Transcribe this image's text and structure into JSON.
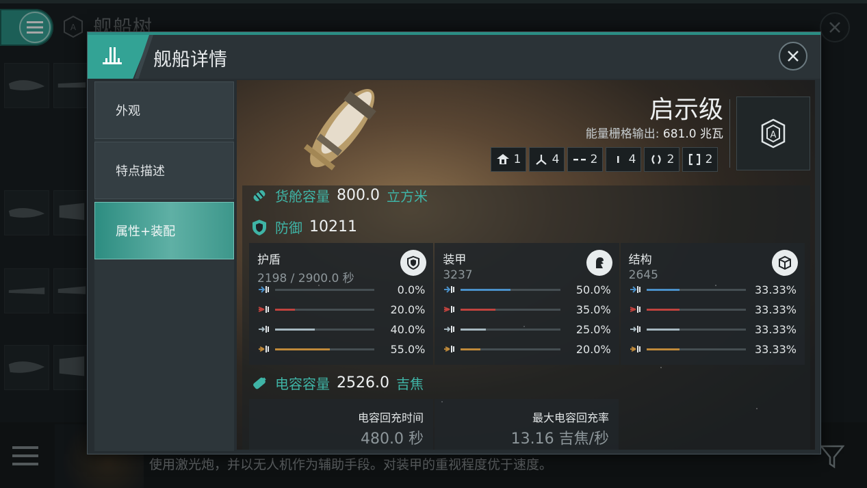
{
  "background": {
    "page_title": "舰船树",
    "description": "使用激光炮，并以无人机作为辅助手段。对装甲的重视程度优于速度。"
  },
  "modal": {
    "title": "舰船详情",
    "sidebar": [
      {
        "label": "外观",
        "active": false
      },
      {
        "label": "特点描述",
        "active": false
      },
      {
        "label": "属性+装配",
        "active": true
      }
    ]
  },
  "ship": {
    "name": "启示级",
    "power_label": "能量栅格输出:",
    "power_value": "681.0",
    "power_unit": "兆瓦",
    "slots": [
      {
        "icon": "high-slot-icon",
        "count": "1"
      },
      {
        "icon": "drone-slot-icon",
        "count": "4"
      },
      {
        "icon": "mid-slot-icon",
        "count": "2"
      },
      {
        "icon": "low-slot-icon",
        "count": "4"
      },
      {
        "icon": "rig-slot-icon",
        "count": "2"
      },
      {
        "icon": "subsystem-slot-icon",
        "count": "2"
      }
    ]
  },
  "cargo": {
    "label": "货舱容量",
    "value": "800.0",
    "unit": "立方米"
  },
  "defense": {
    "label": "防御",
    "value": "10211",
    "columns": [
      {
        "name": "护盾",
        "sub": "2198 / 2900.0 秒",
        "icon": "shield-icon",
        "resists": [
          {
            "type": "em",
            "pct": "0.0%",
            "value": 0.0
          },
          {
            "type": "thermal",
            "pct": "20.0%",
            "value": 0.2
          },
          {
            "type": "kinetic",
            "pct": "40.0%",
            "value": 0.4
          },
          {
            "type": "explosive",
            "pct": "55.0%",
            "value": 0.55
          }
        ]
      },
      {
        "name": "装甲",
        "sub": "3237",
        "icon": "armor-icon",
        "resists": [
          {
            "type": "em",
            "pct": "50.0%",
            "value": 0.5
          },
          {
            "type": "thermal",
            "pct": "35.0%",
            "value": 0.35
          },
          {
            "type": "kinetic",
            "pct": "25.0%",
            "value": 0.25
          },
          {
            "type": "explosive",
            "pct": "20.0%",
            "value": 0.2
          }
        ]
      },
      {
        "name": "结构",
        "sub": "2645",
        "icon": "structure-icon",
        "resists": [
          {
            "type": "em",
            "pct": "33.33%",
            "value": 0.3333
          },
          {
            "type": "thermal",
            "pct": "33.33%",
            "value": 0.3333
          },
          {
            "type": "kinetic",
            "pct": "33.33%",
            "value": 0.3333
          },
          {
            "type": "explosive",
            "pct": "33.33%",
            "value": 0.3333
          }
        ]
      }
    ]
  },
  "capacitor": {
    "label": "电容容量",
    "value": "2526.0",
    "unit": "吉焦",
    "recharge_label": "电容回充时间",
    "recharge_value": "480.0 秒",
    "max_rate_label": "最大电容回充率",
    "max_rate_value": "13.16 吉焦/秒"
  },
  "colors": {
    "accent": "#3fb4a6",
    "em": "#4a90c9",
    "thermal": "#c0433e",
    "kinetic": "#a6b8c0",
    "explosive": "#c08a3a"
  }
}
